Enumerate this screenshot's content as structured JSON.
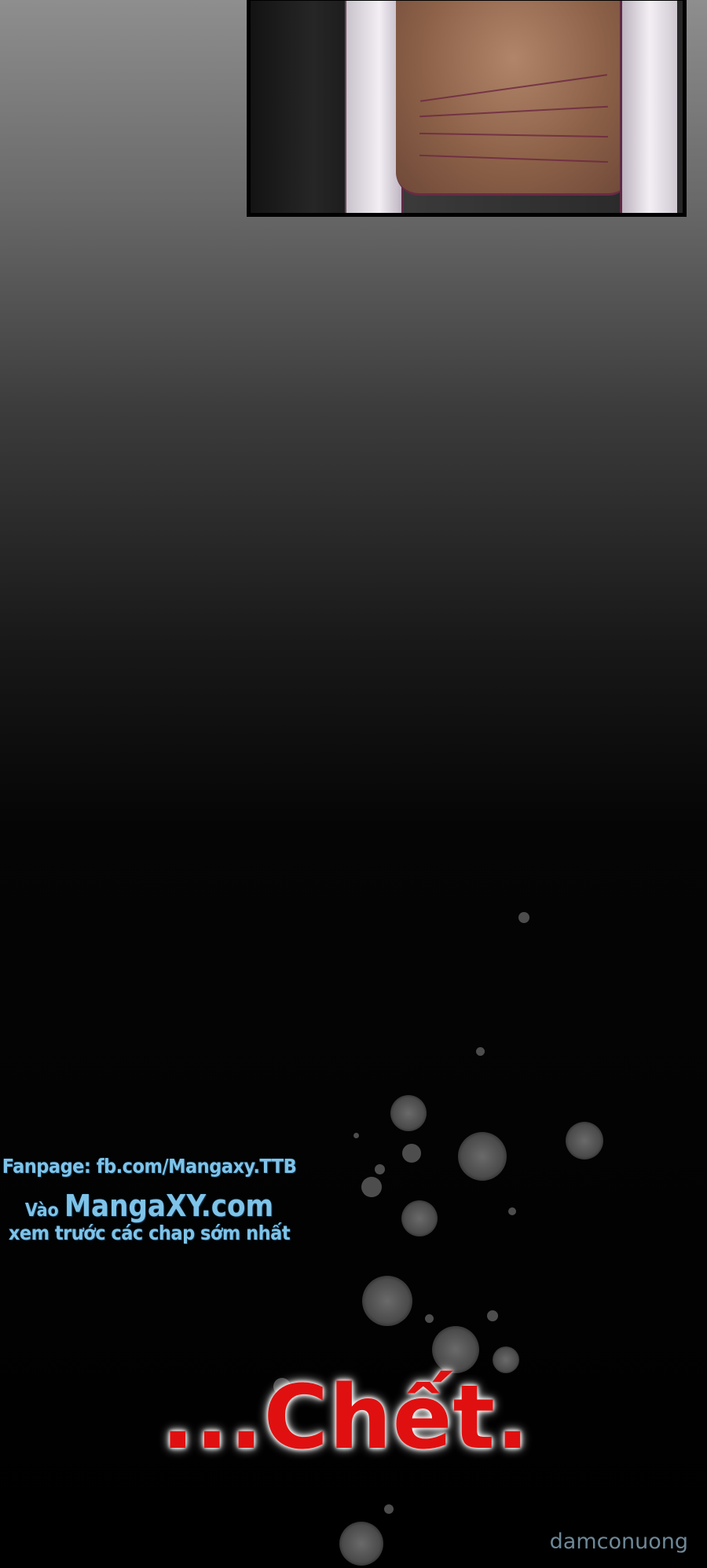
{
  "credits": {
    "fanpage": "Fanpage: fb.com/Mangaxy.TTB",
    "visit_prefix": "Vào",
    "site": "MangaXY.com",
    "early": "xem trước các chap sớm nhất"
  },
  "sfx_text": "...Chết.",
  "watermark": "damconuong"
}
